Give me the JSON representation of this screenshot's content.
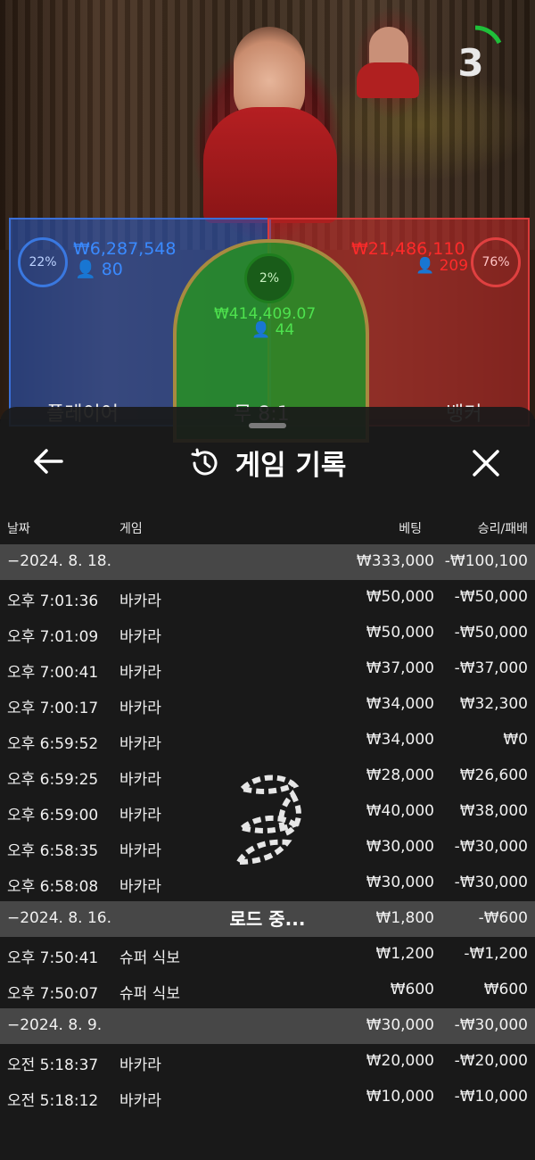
{
  "game": {
    "timer": "3",
    "player": {
      "percent": "22%",
      "amount": "₩6,287,548",
      "count": "80",
      "label": "플레이어"
    },
    "banker": {
      "percent": "76%",
      "amount": "₩21,486,110",
      "count": "209",
      "label": "뱅커"
    },
    "tie": {
      "percent": "2%",
      "amount": "₩414,409.07",
      "count": "44",
      "label": "무 8:1"
    }
  },
  "modal": {
    "title": "게임 기록",
    "columns": {
      "date": "날짜",
      "game": "게임",
      "bet": "베팅",
      "result": "승리/패배"
    },
    "rows": [
      {
        "type": "date",
        "time": "−2024. 8. 18.",
        "game": "",
        "bet": "₩333,000",
        "result": "-₩100,100"
      },
      {
        "type": "item",
        "time": "오후 7:01:36",
        "game": "바카라",
        "bet": "₩50,000",
        "result": "-₩50,000"
      },
      {
        "type": "item",
        "time": "오후 7:01:09",
        "game": "바카라",
        "bet": "₩50,000",
        "result": "-₩50,000"
      },
      {
        "type": "item",
        "time": "오후 7:00:41",
        "game": "바카라",
        "bet": "₩37,000",
        "result": "-₩37,000"
      },
      {
        "type": "item",
        "time": "오후 7:00:17",
        "game": "바카라",
        "bet": "₩34,000",
        "result": "₩32,300"
      },
      {
        "type": "item",
        "time": "오후 6:59:52",
        "game": "바카라",
        "bet": "₩34,000",
        "result": "₩0"
      },
      {
        "type": "item",
        "time": "오후 6:59:25",
        "game": "바카라",
        "bet": "₩28,000",
        "result": "₩26,600"
      },
      {
        "type": "item",
        "time": "오후 6:59:00",
        "game": "바카라",
        "bet": "₩40,000",
        "result": "₩38,000"
      },
      {
        "type": "item",
        "time": "오후 6:58:35",
        "game": "바카라",
        "bet": "₩30,000",
        "result": "-₩30,000"
      },
      {
        "type": "item",
        "time": "오후 6:58:08",
        "game": "바카라",
        "bet": "₩30,000",
        "result": "-₩30,000"
      },
      {
        "type": "date",
        "time": "−2024. 8. 16.",
        "game": "",
        "bet": "₩1,800",
        "result": "-₩600"
      },
      {
        "type": "item",
        "time": "오후 7:50:41",
        "game": "슈퍼 식보",
        "bet": "₩1,200",
        "result": "-₩1,200"
      },
      {
        "type": "item",
        "time": "오후 7:50:07",
        "game": "슈퍼 식보",
        "bet": "₩600",
        "result": "₩600"
      },
      {
        "type": "date",
        "time": "−2024. 8. 9.",
        "game": "",
        "bet": "₩30,000",
        "result": "-₩30,000"
      },
      {
        "type": "item",
        "time": "오전 5:18:37",
        "game": "바카라",
        "bet": "₩20,000",
        "result": "-₩20,000"
      },
      {
        "type": "item",
        "time": "오전 5:18:12",
        "game": "바카라",
        "bet": "₩10,000",
        "result": "-₩10,000"
      }
    ],
    "loading_text": "로드 중..."
  },
  "icons": {
    "back": "arrow-left-icon",
    "close": "close-icon",
    "history": "history-icon",
    "loader": "loading-spinner-icon"
  },
  "colors": {
    "player": "#3a6fd8",
    "banker": "#d83a3a",
    "tie": "#2a8a2a",
    "modal_bg": "#1a1a1a",
    "date_row": "#6e6e6e"
  }
}
